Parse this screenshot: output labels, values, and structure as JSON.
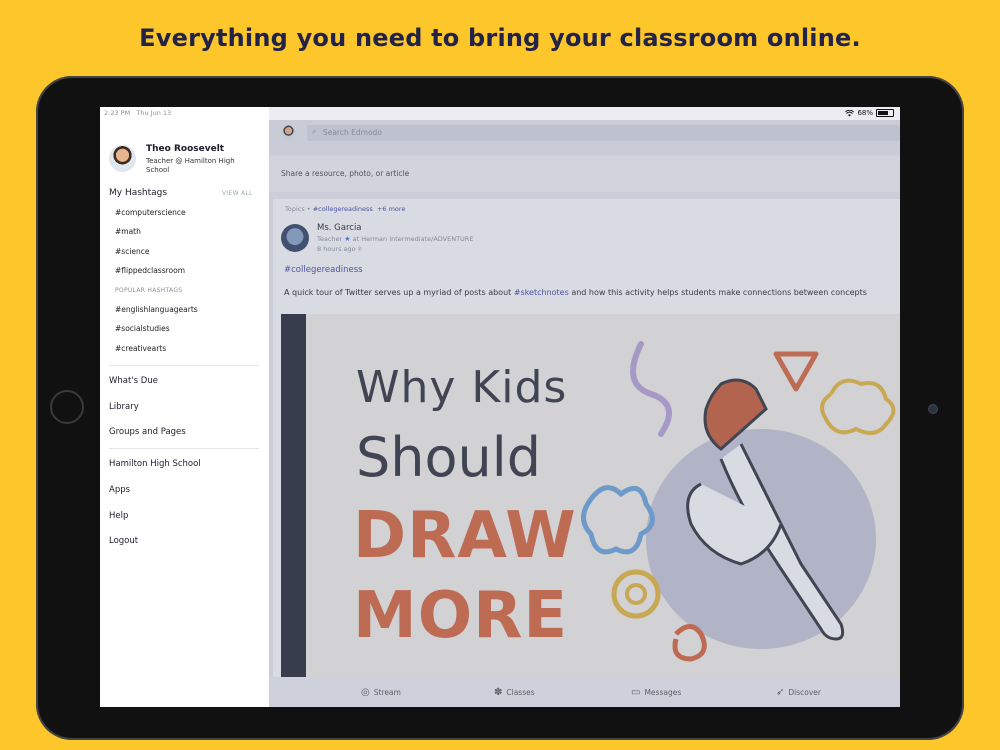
{
  "headline": "Everything you need to bring your classroom online.",
  "status_bar": {
    "time": "2:23 PM",
    "date": "Thu Jun 13",
    "battery": "68%"
  },
  "profile": {
    "name": "Theo Roosevelt",
    "role": "Teacher @ Hamilton High School"
  },
  "hashtags": {
    "title": "My Hashtags",
    "view_all": "VIEW ALL",
    "items": [
      "#computerscience",
      "#math",
      "#science",
      "#flippedclassroom"
    ],
    "popular_title": "POPULAR HASHTAGS",
    "popular": [
      "#englishlanguagearts",
      "#socialstudies",
      "#creativearts"
    ]
  },
  "nav": {
    "group1": [
      "What's Due",
      "Library",
      "Groups and Pages"
    ],
    "group2": [
      "Hamilton High School",
      "Apps",
      "Help",
      "Logout"
    ]
  },
  "search": {
    "placeholder": "Search Edmodo"
  },
  "share": {
    "placeholder": "Share a resource, photo, or article"
  },
  "post": {
    "topics_label": "Topics •",
    "topic_tag": "#collegereadiness",
    "more_topics": "+6 more",
    "author": "Ms. Garcia",
    "role_prefix": "Teacher",
    "role_suffix": "at Herman Intermediate/ADVENTURE",
    "time": "8 hours ago",
    "hashtag": "#collegereadiness",
    "text_before": "A quick tour of Twitter serves up a myriad of posts about",
    "text_link": "#sketchnotes",
    "text_after": "and how this activity helps students make connections between concepts",
    "image_text": [
      "Why Kids",
      "Should",
      "DRAW",
      "MORE"
    ]
  },
  "tabs": [
    "Stream",
    "Classes",
    "Messages",
    "Discover"
  ],
  "colors": {
    "background": "#FDC62A",
    "headline": "#232347",
    "link": "#3b45a8",
    "accent_orange": "#d8643a"
  }
}
